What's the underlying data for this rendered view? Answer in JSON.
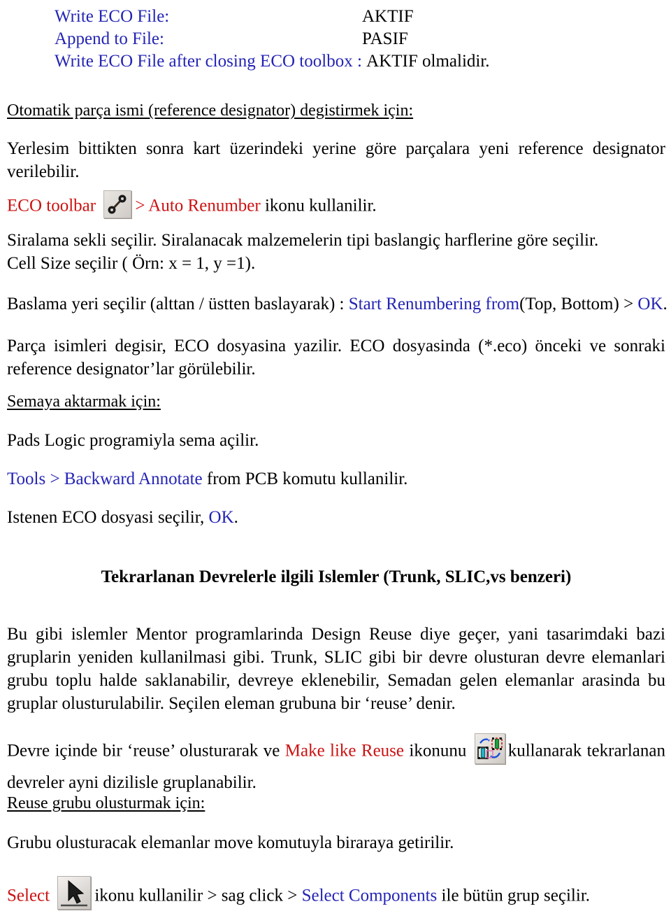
{
  "config_rows": [
    {
      "label": "Write ECO File:",
      "value": "AKTIF"
    },
    {
      "label": "Append to File:",
      "value": "PASIF"
    },
    {
      "label": "Write ECO File after closing ECO toolbox :",
      "value": "AKTIF olmalidir."
    }
  ],
  "sections": {
    "heading_auto_rename": "Otomatik parça ismi (reference designator) degistirmek için:",
    "para_yerlesim": "Yerlesim bittikten sonra kart üzerindeki yerine göre parçalara yeni reference designator verilebilir.",
    "eco_toolbar_line": {
      "prefix": "ECO toolbar",
      "icon": "net-connection-icon",
      "mid": "> Auto Renumber",
      "suffix": "ikonu kullanilir."
    },
    "siralama_line1": "Siralama sekli seçilir. Siralanacak malzemelerin tipi baslangiç harflerine göre seçilir.",
    "siralama_line2": "Cell Size seçilir ( Örn: x = 1, y =1).",
    "baslama_line": {
      "prefix": "Baslama yeri seçilir (alttan / üstten baslayarak) :",
      "blue1": "Start Renumbering from",
      "black1": "(Top, Bottom) >",
      "blue2": "OK",
      "black2": "."
    },
    "para_parca": "Parça isimleri degisir, ECO dosyasina yazilir. ECO dosyasinda (*.eco) önceki ve sonraki reference designator’lar görülebilir.",
    "heading_semaya": "Semaya aktarmak için:",
    "pads_logic_line": "Pads Logic programiyla sema açilir.",
    "tools_line": {
      "blue": "Tools > Backward Annotate",
      "black": "from PCB komutu kullanilir."
    },
    "istenen_line": {
      "black1": "Istenen ECO dosyasi seçilir,",
      "blue": "OK",
      "black2": "."
    },
    "heading_tekrarlanan": "Tekrarlanan Devrelerle ilgili Islemler (Trunk, SLIC,vs benzeri)",
    "para_design_reuse": "Bu gibi islemler Mentor programlarinda Design Reuse diye geçer, yani tasarimdaki bazi gruplarin yeniden kullanilmasi gibi. Trunk, SLIC gibi bir devre olusturan devre elemanlari grubu toplu halde saklanabilir, devreye eklenebilir, Semadan gelen elemanlar arasinda bu gruplar olusturulabilir. Seçilen eleman grubuna bir ‘reuse’ denir.",
    "devre_icinde_line": {
      "black1": "Devre içinde bir  ‘reuse’ olusturarak ve",
      "red": "Make like Reuse",
      "black2": "ikonunu",
      "icon": "make-like-reuse-icon",
      "black3": "kullanarak tekrarlanan devreler ayni dizilisle gruplanabilir."
    },
    "heading_reuse_grubu": "Reuse grubu olusturmak için:",
    "grubu_line": "Grubu olusturacak elemanlar move komutuyla biraraya getirilir.",
    "select_line": {
      "red": "Select",
      "icon": "select-cursor-icon",
      "black1": "ikonu kullanilir > sag click >",
      "blue": "Select Components",
      "black2": "ile bütün grup seçilir."
    }
  },
  "colors": {
    "blue": "#2424b5",
    "red": "#cc1111",
    "black": "#000000",
    "background": "#ffffff"
  }
}
